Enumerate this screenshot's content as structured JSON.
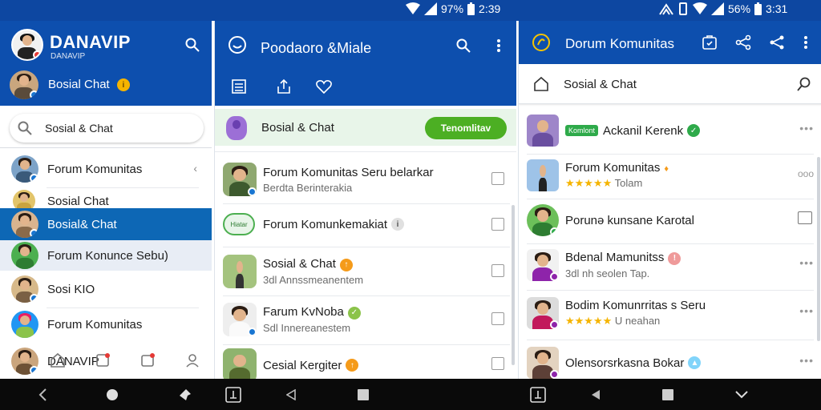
{
  "status_bars": [
    {
      "battery": "97%",
      "time": "2:39"
    },
    {
      "battery": "56%",
      "time": "3:31"
    }
  ],
  "panel1": {
    "brand": {
      "title": "DANAVIP",
      "subtitle": "DANAVIP"
    },
    "user_label": "Bosial Chat",
    "search_value": "Sosial & Chat",
    "items": [
      {
        "label": "Forum Komunitas"
      },
      {
        "label": "Sosial Chat"
      },
      {
        "label": "Bosial& Chat"
      },
      {
        "label": "Forum Konunce Sebu)"
      },
      {
        "label": "Sosi KIO"
      },
      {
        "label": "Forum Komunitas"
      },
      {
        "label": "DANAVIP"
      }
    ]
  },
  "panel2": {
    "title": "Poodaoro &Miale",
    "highlight": {
      "label": "Bosial & Chat",
      "button": "Tenomlitav"
    },
    "items": [
      {
        "name": "Forum Komunitas Seru belarkar",
        "sub": "Berdta Berinterakia"
      },
      {
        "name": "Forum Komunkemakiat",
        "sub": "",
        "tag": "Hiatar"
      },
      {
        "name": "Sosial & Chat",
        "sub": "3dl Annssmeanentem"
      },
      {
        "name": "Farum KvNoba",
        "sub": "Sdl Innereanestem"
      },
      {
        "name": "Cesial Kergiter",
        "sub": ""
      }
    ]
  },
  "panel3": {
    "title": "Dorum Komunitas",
    "section": "Sosial & Chat",
    "items": [
      {
        "tag": "Komlont",
        "name": "Ackanil Kerenk",
        "sub": ""
      },
      {
        "name": "Forum Komunitas",
        "sub": "Tolam"
      },
      {
        "name": "Porunə kunsane Karotal",
        "sub": ""
      },
      {
        "name": "Bdenal Mamunitss",
        "sub": "3dl nh seolen Tap."
      },
      {
        "name": "Bodim Komunrritas s Seru",
        "sub": "U neahan"
      },
      {
        "name": "Olensorsrkasna Bokar",
        "sub": ""
      }
    ]
  }
}
